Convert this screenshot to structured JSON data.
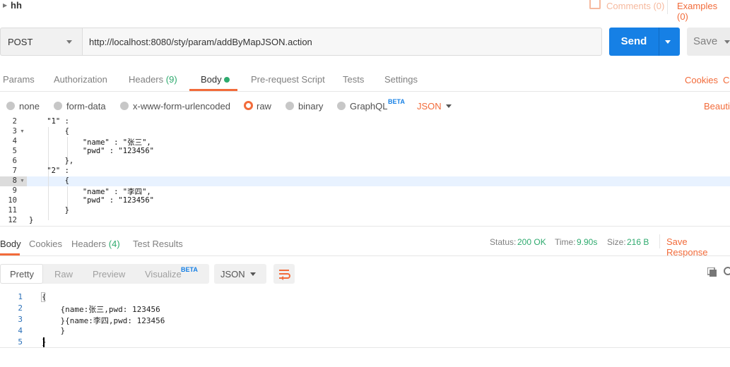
{
  "request": {
    "name": "hh",
    "comments_label": "Comments (0)",
    "examples_label": "Examples (0)",
    "method": "POST",
    "url": "http://localhost:8080/sty/param/addByMapJSON.action",
    "send_label": "Send",
    "save_label": "Save"
  },
  "request_tabs": {
    "params": "Params",
    "authorization": "Authorization",
    "headers": "Headers",
    "headers_count": "(9)",
    "body": "Body",
    "prerequest": "Pre-request Script",
    "tests": "Tests",
    "settings": "Settings",
    "cookies": "Cookies",
    "code": "Co"
  },
  "body_types": {
    "none": "none",
    "form_data": "form-data",
    "urlencoded": "x-www-form-urlencoded",
    "raw": "raw",
    "binary": "binary",
    "graphql": "GraphQL",
    "beta": "BETA",
    "format": "JSON",
    "beautify": "Beautify"
  },
  "request_editor": {
    "line_numbers": [
      "2",
      "3",
      "4",
      "5",
      "6",
      "7",
      "8",
      "9",
      "10",
      "11",
      "12"
    ],
    "lines": [
      "    \"1\" :",
      "        {",
      "            \"name\" : \"张三\",",
      "            \"pwd\" : \"123456\"",
      "        },",
      "    \"2\" :",
      "        {",
      "            \"name\" : \"李四\",",
      "            \"pwd\" : \"123456\"",
      "        }",
      "}"
    ]
  },
  "response_tabs": {
    "body": "Body",
    "cookies": "Cookies",
    "headers": "Headers",
    "headers_count": "(4)",
    "test_results": "Test Results",
    "status_label": "Status:",
    "status_value": "200 OK",
    "time_label": "Time:",
    "time_value": "9.90s",
    "size_label": "Size:",
    "size_value": "216 B",
    "save_response": "Save Response"
  },
  "response_toolbar": {
    "pretty": "Pretty",
    "raw": "Raw",
    "preview": "Preview",
    "visualize": "Visualize",
    "beta": "BETA",
    "format": "JSON"
  },
  "response_body": {
    "line_numbers": [
      "1",
      "2",
      "3",
      "4",
      "5"
    ],
    "lines": [
      "{",
      "    {name:张三,pwd: 123456",
      "    }{name:李四,pwd: 123456",
      "    }",
      "}"
    ]
  },
  "colors": {
    "accent": "#f26b3a",
    "send_blue": "#1680e5",
    "status_green": "#2eaa6e"
  }
}
